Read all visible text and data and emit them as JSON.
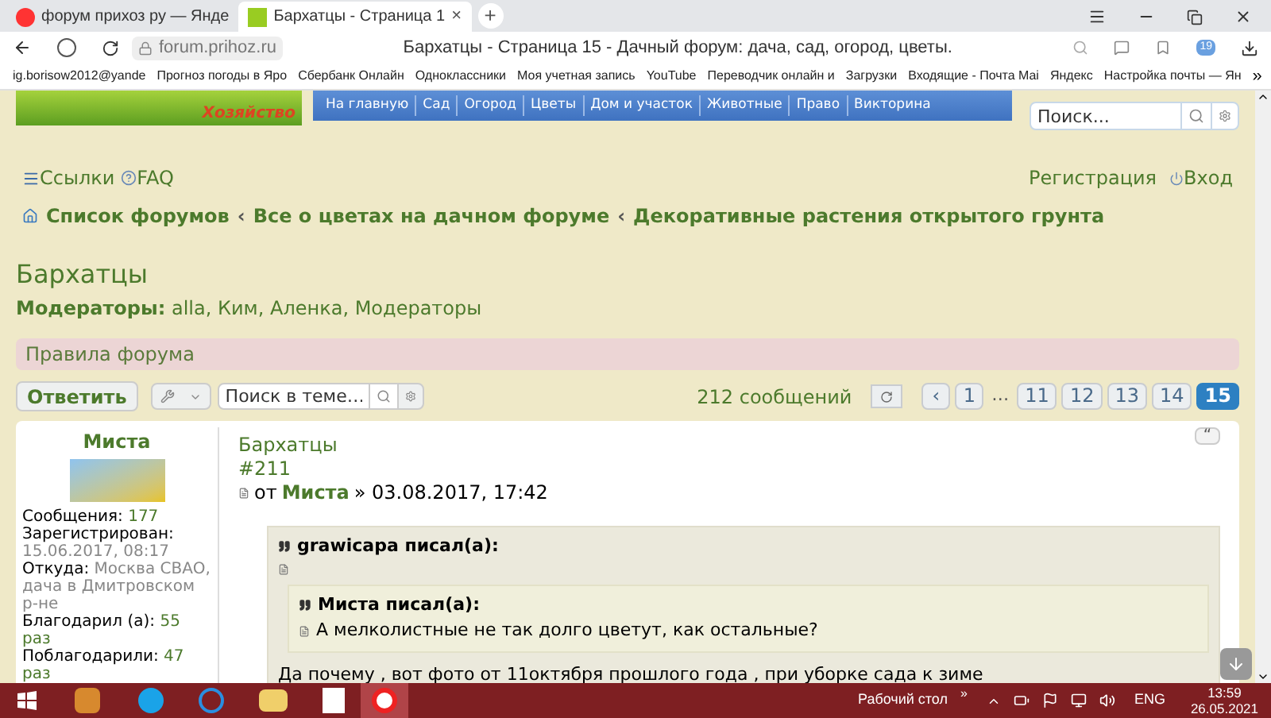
{
  "browser": {
    "tabs": [
      {
        "title": "форум прихоз ру — Янде",
        "selected": false
      },
      {
        "title": "Бархатцы - Страница 1",
        "selected": true,
        "close": "×"
      }
    ],
    "new_tab": "+",
    "url": "forum.prihoz.ru",
    "page_title": "Бархатцы - Страница 15 - Дачный форум: дача, сад, огород, цветы.",
    "calendar_badge": "19",
    "bookmarks": [
      "ig.borisow2012@yande",
      "Прогноз погоды в Яро",
      "Сбербанк Онлайн",
      "Одноклассники",
      "Моя учетная запись",
      "YouTube",
      "Переводчик онлайн и",
      "Загрузки",
      "Входящие - Почта Mai",
      "Яндекс",
      "Настройка почты — Ян"
    ],
    "bookmarks_more": "»"
  },
  "site_header": {
    "logo_text": "Хозяйство",
    "nav": [
      "На главную",
      "Сад",
      "Огород",
      "Цветы",
      "Дом и участок",
      "Животные",
      "Право",
      "Викторина"
    ],
    "search": {
      "placeholder": "Поиск..."
    }
  },
  "top_links": {
    "left": [
      "Ссылки",
      "FAQ"
    ],
    "right": [
      "Регистрация",
      "Вход"
    ]
  },
  "breadcrumbs": [
    "Список форумов",
    "Все о цветах на дачном форуме",
    "Декоративные растения открытого грунта"
  ],
  "breadcrumb_separator": "‹",
  "forum": {
    "title": "Бархатцы",
    "moderators_label": "Модераторы:",
    "moderators": "alla, Ким, Аленка, Модераторы",
    "rules": "Правила форума"
  },
  "toolbar": {
    "reply": "Ответить",
    "search": {
      "placeholder": "Поиск в теме…"
    },
    "post_count": "212 сообщений",
    "pages": [
      {
        "kind": "prev",
        "label": "‹"
      },
      {
        "kind": "page",
        "label": "1",
        "selected": false
      },
      {
        "kind": "ellipsis",
        "label": "…"
      },
      {
        "kind": "page",
        "label": "11",
        "selected": false
      },
      {
        "kind": "page",
        "label": "12",
        "selected": false
      },
      {
        "kind": "page",
        "label": "13",
        "selected": false
      },
      {
        "kind": "page",
        "label": "14",
        "selected": false
      },
      {
        "kind": "page",
        "label": "15",
        "selected": true
      }
    ]
  },
  "post": {
    "author": "Миста",
    "stats": [
      {
        "label": "Сообщения:",
        "value": "177"
      },
      {
        "label": "Зарегистрирован:",
        "value": "15.06.2017, 08:17"
      },
      {
        "label": "Откуда:",
        "value": "Москва СВАО, дача в Дмитровском р-не"
      },
      {
        "label": "Благодарил (а):",
        "value": "55 раз"
      },
      {
        "label": "Поблагодарили:",
        "value": "47 раз"
      }
    ],
    "title": "Бархатцы",
    "number": "#211",
    "by": "от",
    "by_author": "Миста",
    "date": "» 03.08.2017, 17:42",
    "quote_button": "“",
    "quote": {
      "author": "grawicapa писал(а):",
      "inner": {
        "author": "Миста писал(а):",
        "text": "А мелколистные не так долго цветут, как остальные?"
      }
    },
    "body": "Да почему , вот фото от 11октября прошлого года , при уборке сада к зиме"
  },
  "taskbar": {
    "desktop_label": "Рабочий стол",
    "more": "»",
    "language": "ENG",
    "time": "13:59",
    "date": "26.05.2021"
  }
}
